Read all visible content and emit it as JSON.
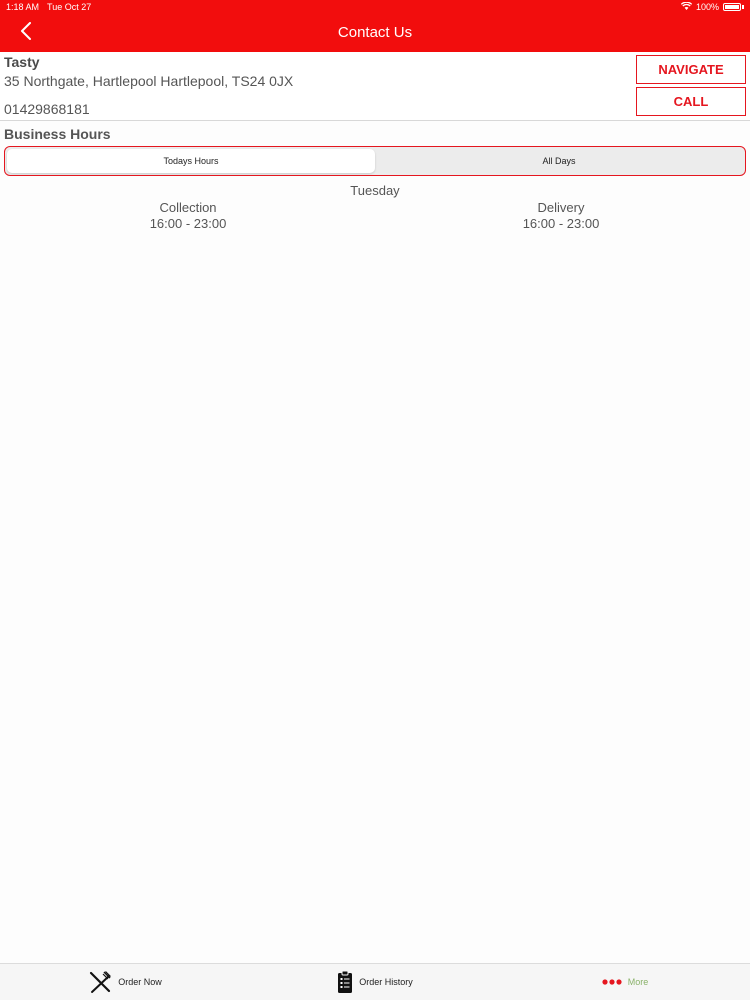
{
  "status_bar": {
    "time": "1:18 AM",
    "date": "Tue Oct 27",
    "battery": "100%"
  },
  "nav": {
    "title": "Contact Us",
    "back_icon": "chevron-left-icon"
  },
  "contact": {
    "name": "Tasty",
    "address": "35 Northgate, Hartlepool Hartlepool, TS24 0JX",
    "phone": "01429868181",
    "navigate_label": "NAVIGATE",
    "call_label": "CALL"
  },
  "business_hours": {
    "title": "Business Hours",
    "tabs": [
      {
        "label": "Todays Hours",
        "selected": true
      },
      {
        "label": "All Days",
        "selected": false
      }
    ],
    "day": "Tuesday",
    "collection": {
      "label": "Collection",
      "hours": "16:00 - 23:00"
    },
    "delivery": {
      "label": "Delivery",
      "hours": "16:00 - 23:00"
    }
  },
  "tab_bar": {
    "items": [
      {
        "label": "Order Now",
        "icon": "fork-knife-icon"
      },
      {
        "label": "Order History",
        "icon": "clipboard-icon"
      },
      {
        "label": "More",
        "icon": "more-dots-icon"
      }
    ]
  },
  "colors": {
    "brand_red": "#f20d0d",
    "button_red": "#e5161f",
    "more_green": "#8ab26a"
  }
}
